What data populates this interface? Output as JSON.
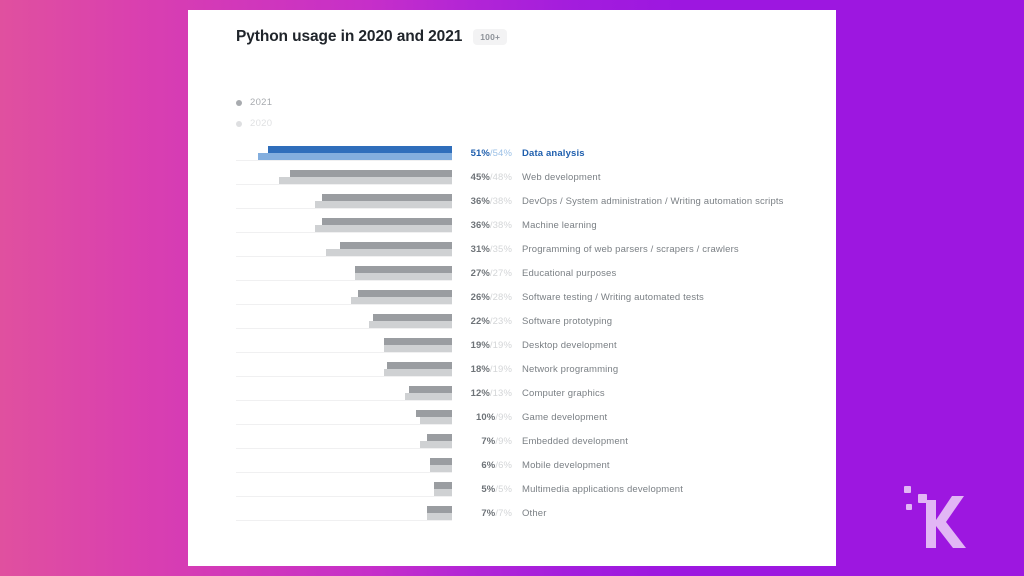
{
  "background": {
    "gradient_from": "#e0509f",
    "gradient_to": "#9d17e0"
  },
  "watermark": {
    "name": "knowtechie-k-logo",
    "color": "#e2b6f5"
  },
  "card": {
    "title": "Python usage in 2020 and 2021",
    "badge": "100+",
    "legend": [
      {
        "label": "2021",
        "color": "#a8abaf"
      },
      {
        "label": "2020",
        "color": "#dedfe1"
      }
    ],
    "accent_color": "#2f6ebb",
    "bar_color_2021": "#9a9da1",
    "bar_color_2020": "#cfd1d3"
  },
  "chart_data": {
    "type": "bar",
    "title": "Python usage in 2020 and 2021",
    "xlabel": "",
    "ylabel": "",
    "orientation": "horizontal",
    "bars_right_aligned": true,
    "xlim": [
      0,
      60
    ],
    "grid": false,
    "legend_position": "top-left",
    "categories": [
      "Data analysis",
      "Web development",
      "DevOps / System administration / Writing automation scripts",
      "Machine learning",
      "Programming of web parsers / scrapers / crawlers",
      "Educational purposes",
      "Software testing / Writing automated tests",
      "Software prototyping",
      "Desktop development",
      "Network programming",
      "Computer graphics",
      "Game development",
      "Embedded development",
      "Mobile development",
      "Multimedia applications development",
      "Other"
    ],
    "series": [
      {
        "name": "2021",
        "values": [
          51,
          45,
          36,
          36,
          31,
          27,
          26,
          22,
          19,
          18,
          12,
          10,
          7,
          6,
          5,
          7
        ]
      },
      {
        "name": "2020",
        "values": [
          54,
          48,
          38,
          38,
          35,
          27,
          28,
          23,
          19,
          19,
          13,
          9,
          9,
          6,
          5,
          7
        ]
      }
    ],
    "value_labels": [
      "51%/54%",
      "45%/48%",
      "36%/38%",
      "36%/38%",
      "31%/35%",
      "27%/27%",
      "26%/28%",
      "22%/23%",
      "19%/19%",
      "18%/19%",
      "12%/13%",
      "10%/9%",
      "7%/9%",
      "6%/6%",
      "5%/5%",
      "7%/7%"
    ],
    "highlighted_index": 0
  }
}
